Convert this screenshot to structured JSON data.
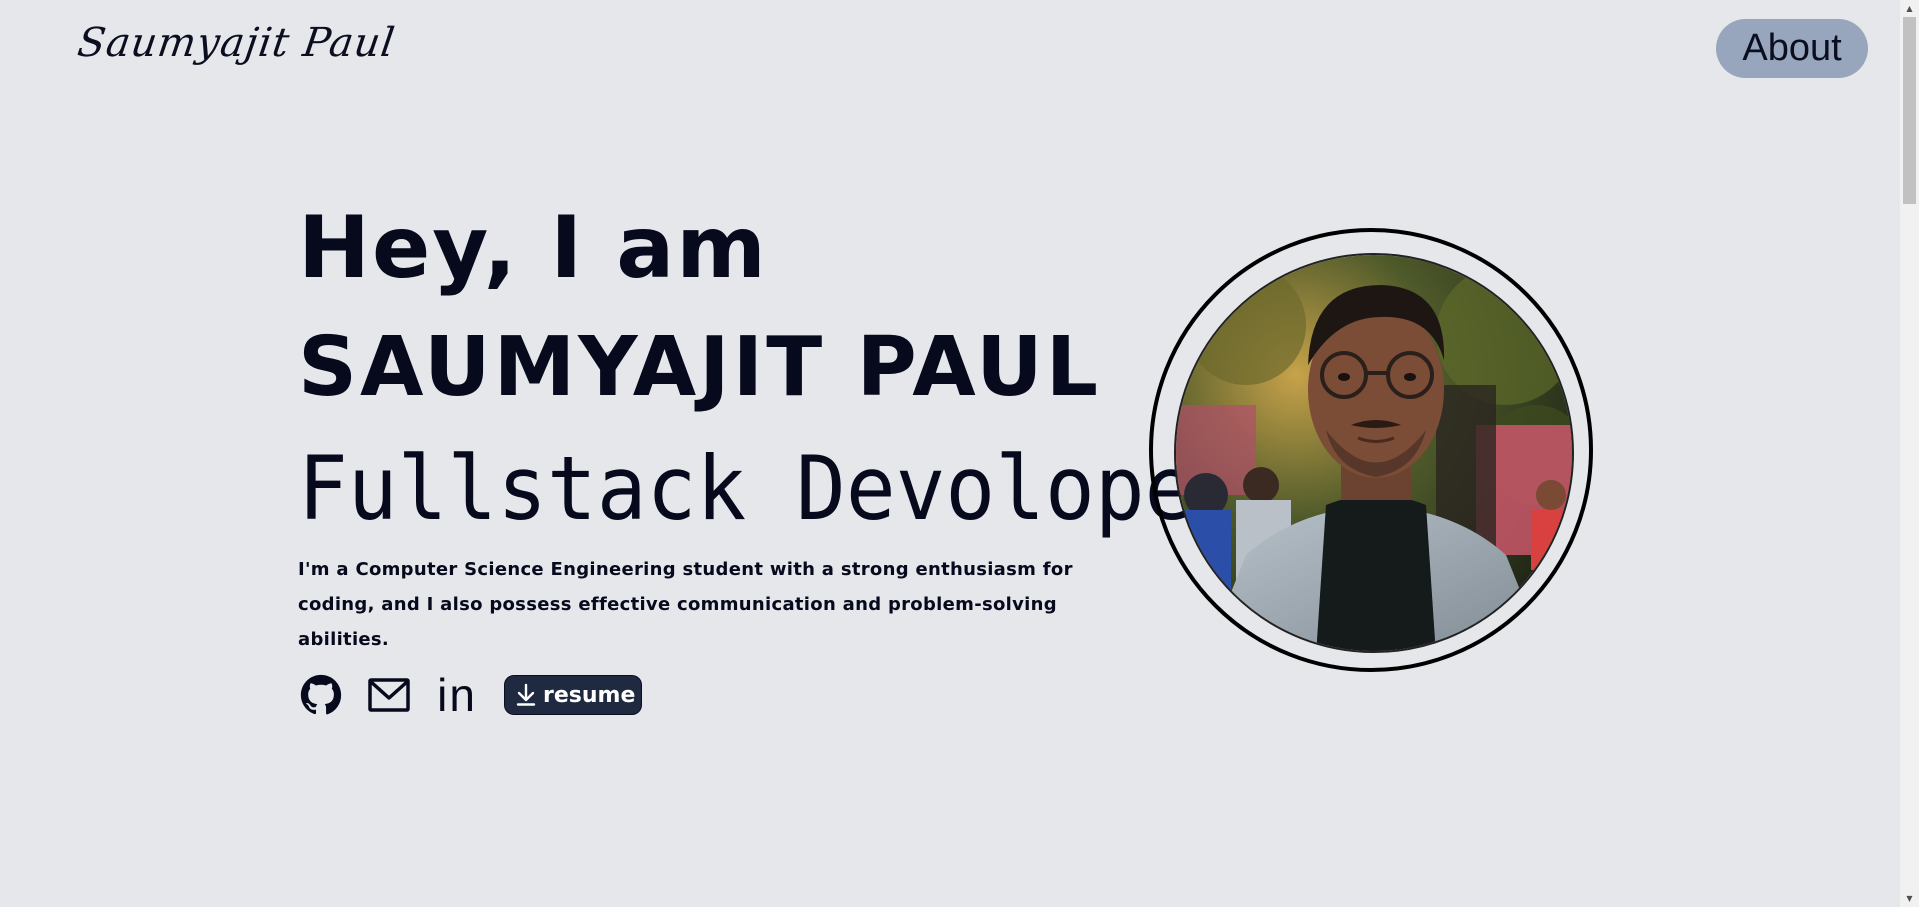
{
  "header": {
    "logo_text": "Saumyajit Paul",
    "nav_about_label": "About"
  },
  "hero": {
    "greeting": "Hey, I am",
    "name": "SAUMYAJIT PAUL",
    "role": "Fullstack Devoloper",
    "description": "I'm a Computer Science Engineering student with a strong enthusiasm for coding, and I also possess effective communication and problem-solving abilities.",
    "socials": [
      {
        "icon": "github-icon"
      },
      {
        "icon": "mail-icon"
      },
      {
        "icon": "linkedin-icon",
        "label": "in"
      }
    ],
    "resume_label": "resume"
  },
  "colors": {
    "background": "#e5e7eb",
    "text": "#060a1c",
    "about_button": "#97a6bd",
    "resume_button": "#1f2a40"
  }
}
